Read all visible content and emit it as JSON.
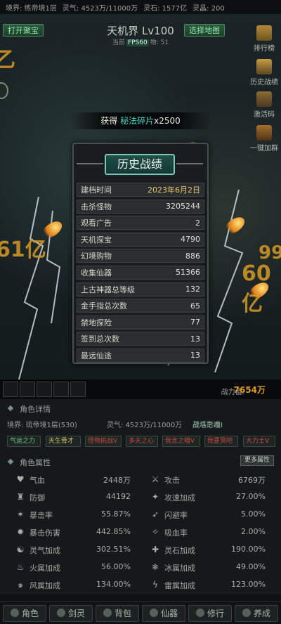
{
  "top_bar": {
    "realm": "境界: 练帝境1层",
    "qi": "灵气: 4523万/11000万",
    "stones": "灵石: 1577亿",
    "spirit": "灵晶: 200"
  },
  "scene": {
    "open_bag_btn": "打开聚宝",
    "select_map_btn": "选择地图",
    "map_title": "天机界 Lv100",
    "fps_prefix": "当前",
    "fps_tag": "FPS60",
    "kills_suffix": "物: 51",
    "left_damage_top": "乙",
    "left_damage_mid": "61亿",
    "right_damage_top": "99",
    "right_damage_mid": "60亿",
    "side_menu": [
      {
        "label": "排行榜",
        "icon": "rank-icon"
      },
      {
        "label": "历史战绩",
        "icon": "history-icon"
      },
      {
        "label": "激活码",
        "icon": "code-icon"
      },
      {
        "label": "一键加群",
        "icon": "group-icon"
      }
    ]
  },
  "reward": {
    "prefix": "获得",
    "item": "秘法碎片",
    "amount": "x2500"
  },
  "history": {
    "title": "历史战绩",
    "rows": [
      {
        "label": "建档时间",
        "value": "2023年6月2日"
      },
      {
        "label": "击杀怪物",
        "value": "3205244"
      },
      {
        "label": "观看广告",
        "value": "2"
      },
      {
        "label": "天机探宝",
        "value": "4790"
      },
      {
        "label": "幻境购物",
        "value": "886"
      },
      {
        "label": "收集仙器",
        "value": "51366"
      },
      {
        "label": "上古神器总等级",
        "value": "132"
      },
      {
        "label": "金手指总次数",
        "value": "65"
      },
      {
        "label": "禁地探险",
        "value": "77"
      },
      {
        "label": "签到总次数",
        "value": "13"
      },
      {
        "label": "最远仙途",
        "value": "13"
      }
    ]
  },
  "skills": {
    "power_label": "战力值:",
    "power_value": "7654万"
  },
  "character": {
    "details_title": "角色详情",
    "realm": "境界: 琉帝境1层(530)",
    "qi": "灵气: 4523万/11000万",
    "form_label": "战斗形态: ",
    "form_value": "灵塔之魂I",
    "tags": [
      "气运之力",
      "天生骨才",
      "怪物挑战V",
      "多天之心",
      "我言之唱V",
      "我要哭吧",
      "大力士V"
    ],
    "attrs_title": "角色属性",
    "more_attrs": "更多属性",
    "attributes": [
      {
        "label": "气血",
        "value": "2448万",
        "icon": "heart-icon"
      },
      {
        "label": "攻击",
        "value": "6769万",
        "icon": "sword-icon"
      },
      {
        "label": "防御",
        "value": "44192",
        "icon": "armor-icon"
      },
      {
        "label": "攻速加成",
        "value": "27.00%",
        "icon": "attack-speed-icon"
      },
      {
        "label": "暴击率",
        "value": "55.87%",
        "icon": "crit-rate-icon"
      },
      {
        "label": "闪避率",
        "value": "5.00%",
        "icon": "dodge-icon"
      },
      {
        "label": "暴击伤害",
        "value": "442.85%",
        "icon": "crit-damage-icon"
      },
      {
        "label": "吸血率",
        "value": "2.00%",
        "icon": "lifesteal-icon"
      },
      {
        "label": "灵气加成",
        "value": "302.51%",
        "icon": "qi-bonus-icon"
      },
      {
        "label": "灵石加成",
        "value": "190.00%",
        "icon": "stone-bonus-icon"
      },
      {
        "label": "火属加成",
        "value": "56.00%",
        "icon": "fire-icon"
      },
      {
        "label": "冰属加成",
        "value": "49.00%",
        "icon": "ice-icon"
      },
      {
        "label": "风属加成",
        "value": "134.00%",
        "icon": "wind-icon"
      },
      {
        "label": "雷属加成",
        "value": "123.00%",
        "icon": "thunder-icon"
      }
    ]
  },
  "bottom_nav": [
    {
      "label": "角色",
      "icon": "character-icon"
    },
    {
      "label": "剑灵",
      "icon": "sword-spirit-icon"
    },
    {
      "label": "背包",
      "icon": "bag-icon"
    },
    {
      "label": "仙器",
      "icon": "artifact-icon"
    },
    {
      "label": "修行",
      "icon": "cultivate-icon"
    },
    {
      "label": "养成",
      "icon": "growth-icon"
    }
  ],
  "colors": {
    "accent_gold": "#d79a26",
    "panel_teal": "#1f4f47",
    "reward_item": "#4fd6c8"
  }
}
